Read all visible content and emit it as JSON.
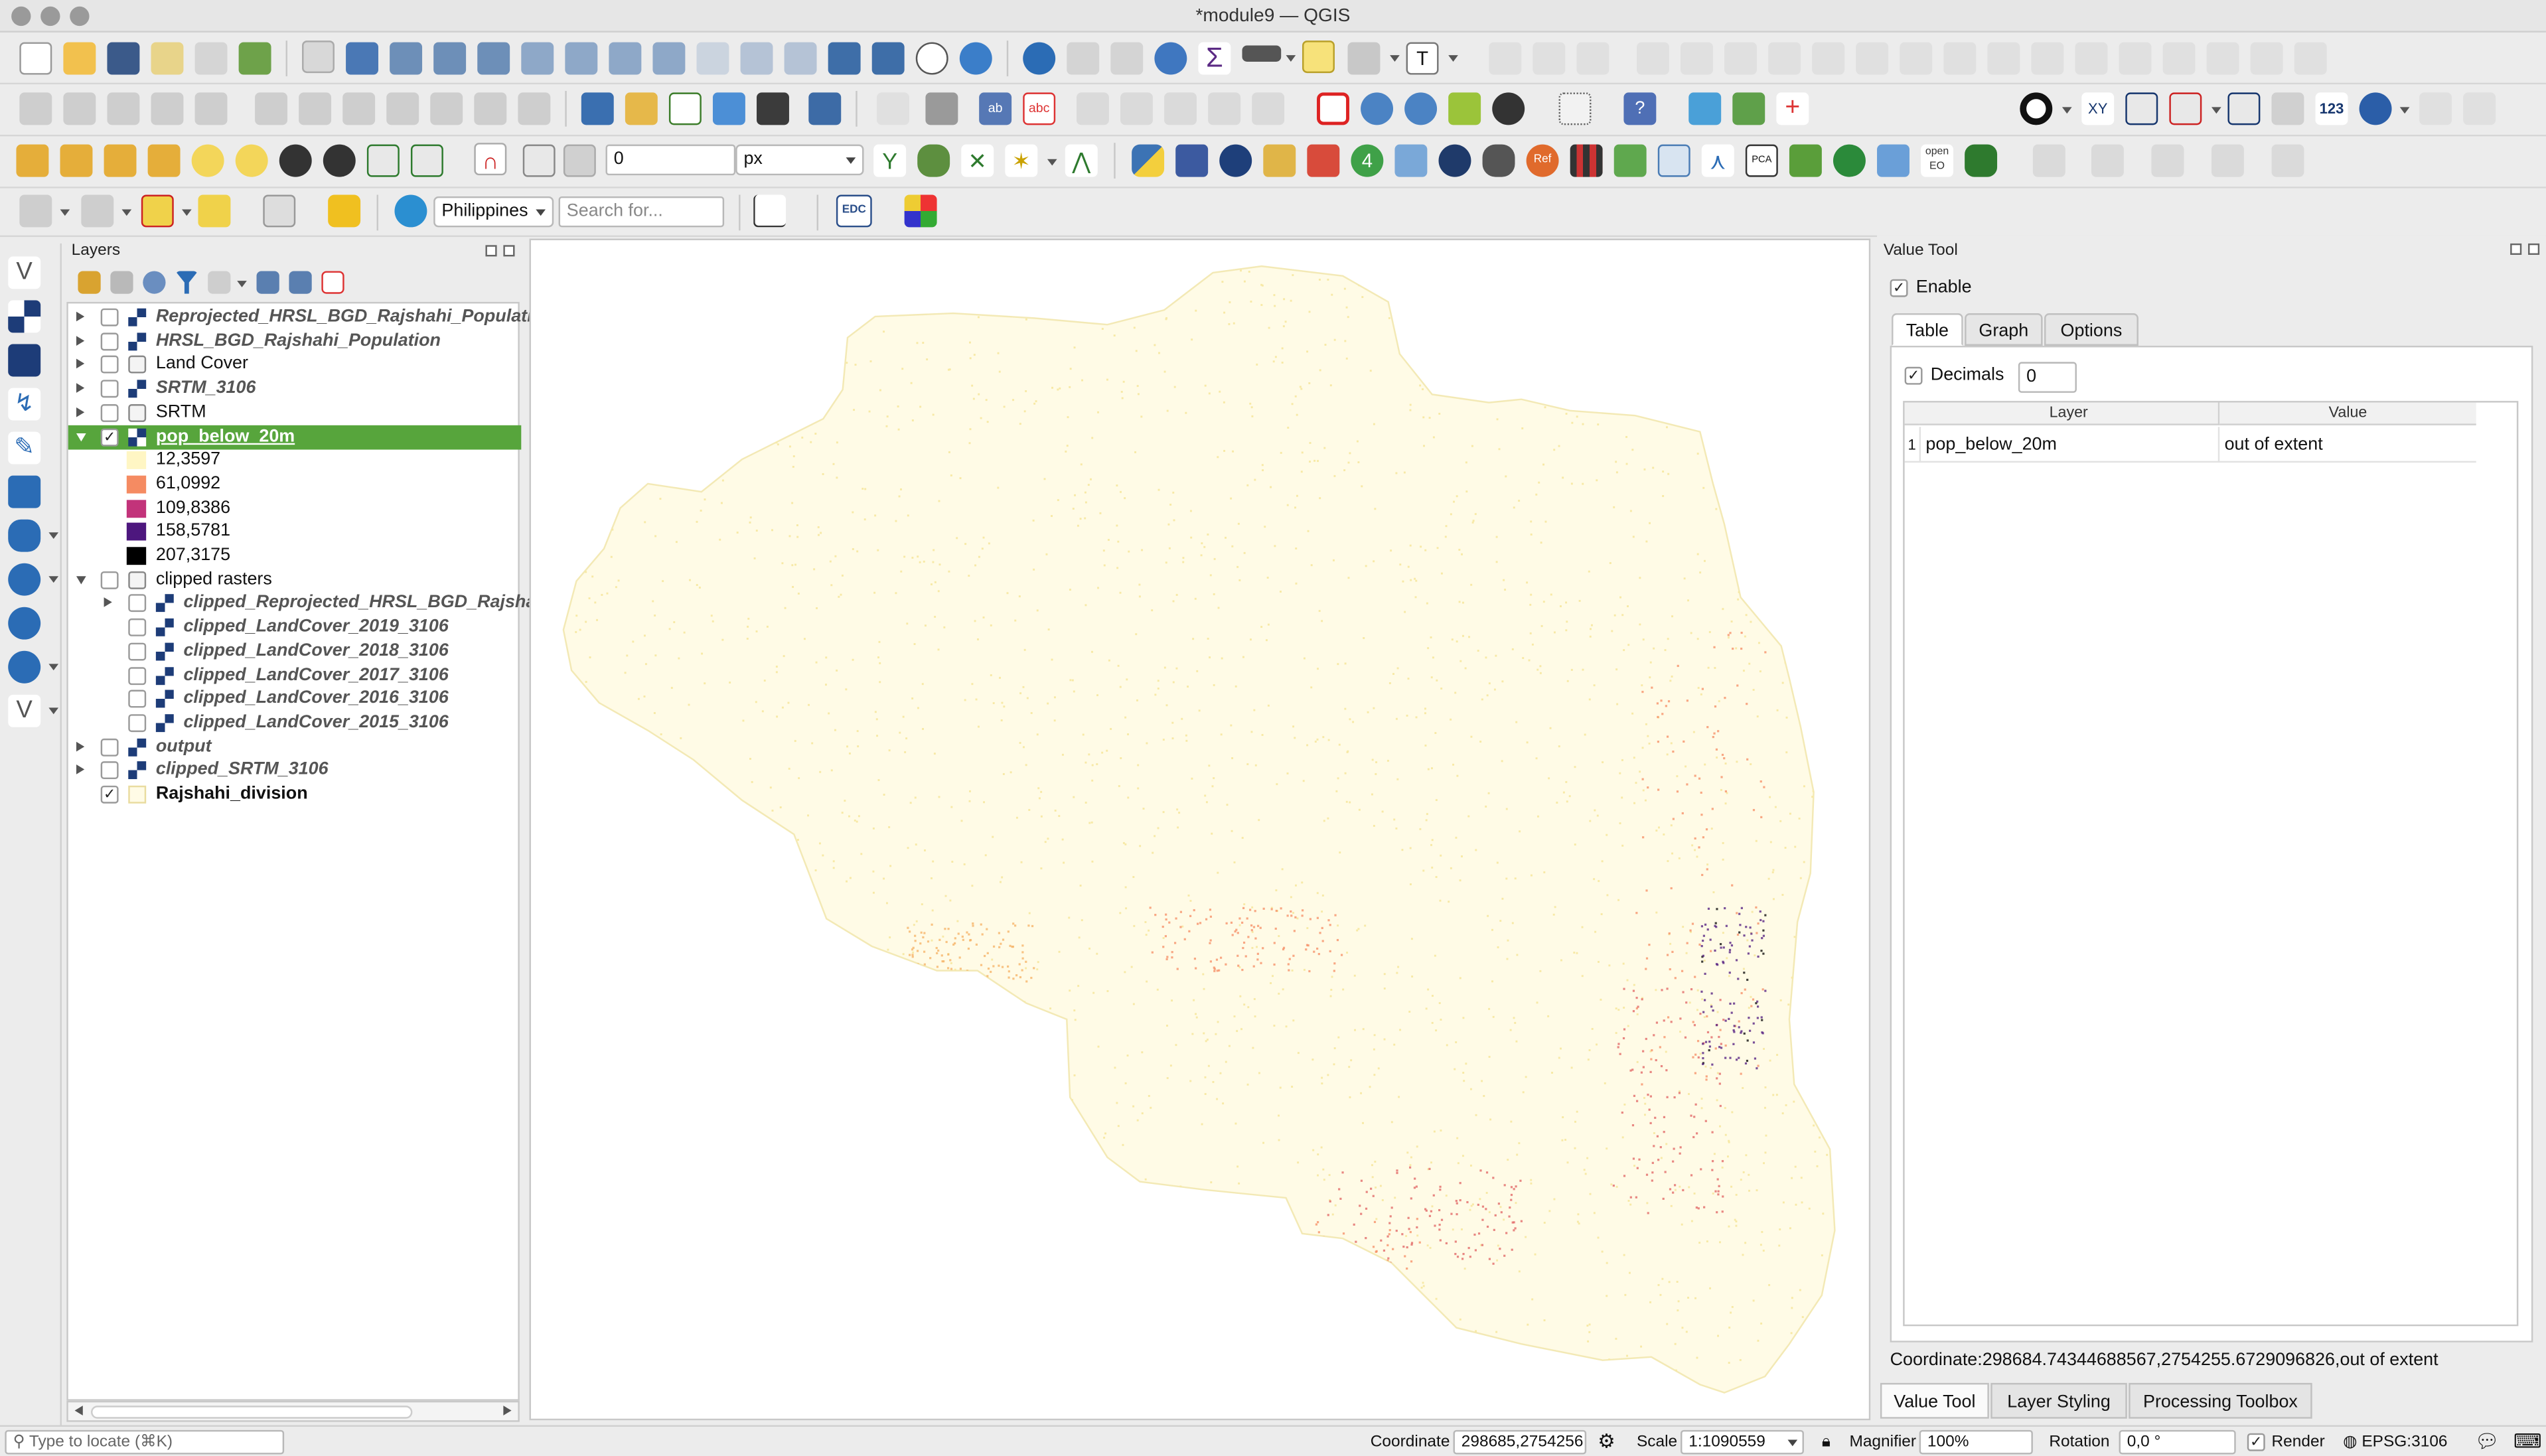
{
  "window": {
    "title": "*module9 — QGIS"
  },
  "toolbar": {
    "snap_tolerance_value": "0",
    "snap_unit": "px",
    "locator_country": "Philippines",
    "search_placeholder": "Search for...",
    "edc_label": "EDC",
    "ref_label": "Ref",
    "pca_label": "PCA",
    "openeo_label": "open EO",
    "label_123": "123",
    "xy_label": "XY"
  },
  "layers_panel": {
    "title": "Layers",
    "items": [
      {
        "label": "Reprojected_HRSL_BGD_Rajshahi_Populatic",
        "type": "raster",
        "checked": false,
        "italic": true,
        "expander": "closed"
      },
      {
        "label": "HRSL_BGD_Rajshahi_Population",
        "type": "raster",
        "checked": false,
        "italic": true,
        "expander": "closed"
      },
      {
        "label": "Land Cover",
        "type": "group",
        "checked": false,
        "italic": false,
        "expander": "closed"
      },
      {
        "label": "SRTM_3106",
        "type": "raster",
        "checked": false,
        "italic": true,
        "expander": "closed"
      },
      {
        "label": "SRTM",
        "type": "group",
        "checked": false,
        "italic": false,
        "expander": "closed"
      },
      {
        "label": "pop_below_20m",
        "type": "raster",
        "checked": true,
        "italic": false,
        "expander": "open",
        "selected": true
      },
      {
        "label": "clipped rasters",
        "type": "group",
        "checked": false,
        "italic": false,
        "expander": "open"
      },
      {
        "label": "clipped_Reprojected_HRSL_BGD_Rajsha",
        "type": "raster",
        "checked": false,
        "italic": true,
        "expander": "closed",
        "indent": 1
      },
      {
        "label": "clipped_LandCover_2019_3106",
        "type": "raster",
        "checked": false,
        "italic": true,
        "indent": 1
      },
      {
        "label": "clipped_LandCover_2018_3106",
        "type": "raster",
        "checked": false,
        "italic": true,
        "indent": 1
      },
      {
        "label": "clipped_LandCover_2017_3106",
        "type": "raster",
        "checked": false,
        "italic": true,
        "indent": 1
      },
      {
        "label": "clipped_LandCover_2016_3106",
        "type": "raster",
        "checked": false,
        "italic": true,
        "indent": 1
      },
      {
        "label": "clipped_LandCover_2015_3106",
        "type": "raster",
        "checked": false,
        "italic": true,
        "indent": 1
      },
      {
        "label": "output",
        "type": "raster",
        "checked": false,
        "italic": true,
        "expander": "closed"
      },
      {
        "label": "clipped_SRTM_3106",
        "type": "raster",
        "checked": false,
        "italic": true,
        "expander": "closed"
      },
      {
        "label": "Rajshahi_division",
        "type": "vector",
        "checked": true,
        "italic": false,
        "bold": true
      }
    ],
    "legend": [
      {
        "label": "12,3597",
        "color": "#fff6c4"
      },
      {
        "label": "61,0992",
        "color": "#f58b62"
      },
      {
        "label": "109,8386",
        "color": "#c2337a"
      },
      {
        "label": "158,5781",
        "color": "#4d177e"
      },
      {
        "label": "207,3175",
        "color": "#000000"
      }
    ]
  },
  "map": {
    "fill_color": "#fffbe6",
    "outline_color": "#f3e9b5"
  },
  "value_tool": {
    "title": "Value Tool",
    "enable_label": "Enable",
    "enable_checked": true,
    "tabs": [
      "Table",
      "Graph",
      "Options"
    ],
    "active_tab": "Table",
    "decimals_label": "Decimals",
    "decimals_checked": true,
    "decimals_value": "0",
    "columns": [
      "Layer",
      "Value"
    ],
    "rows": [
      {
        "index": "1",
        "layer": "pop_below_20m",
        "value": "out of extent"
      }
    ],
    "coordinate_text": "Coordinate:298684.74344688567,2754255.6729096826,out of extent"
  },
  "bottom_tabs": [
    "Value Tool",
    "Layer Styling",
    "Processing Toolbox"
  ],
  "status_bar": {
    "locate_placeholder": "Type to locate (⌘K)",
    "coordinate_label": "Coordinate",
    "coordinate_value": "298685,2754256",
    "scale_label": "Scale",
    "scale_value": "1:1090559",
    "magnifier_label": "Magnifier",
    "magnifier_value": "100%",
    "rotation_label": "Rotation",
    "rotation_value": "0,0 °",
    "render_label": "Render",
    "render_checked": true,
    "crs": "EPSG:3106"
  }
}
